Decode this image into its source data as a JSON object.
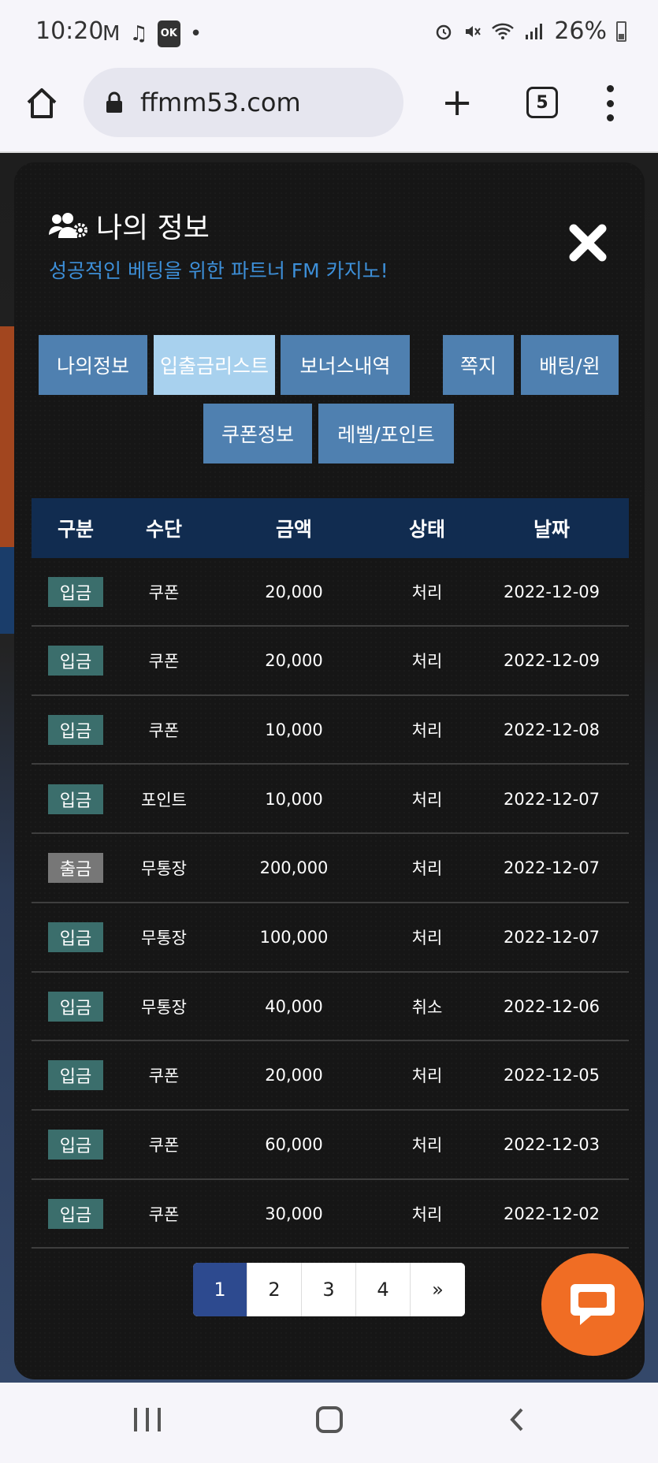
{
  "status_bar": {
    "time": "10:20",
    "left_icons": [
      "gmail-icon",
      "music-icon",
      "ok-icon",
      "dot-icon"
    ],
    "ok_label": "OK",
    "battery": "26%"
  },
  "browser": {
    "url": "ffmm53.com",
    "tab_count": "5"
  },
  "modal": {
    "title": "나의 정보",
    "subtitle": "성공적인 베팅을 위한 파트너 FM 카지노!",
    "tabs": [
      {
        "label": "나의정보",
        "active": false
      },
      {
        "label": "입출금리스트",
        "active": true
      },
      {
        "label": "보너스내역",
        "active": false
      },
      {
        "label": "쪽지",
        "active": false
      },
      {
        "label": "배팅/윈",
        "active": false
      },
      {
        "label": "쿠폰정보",
        "active": false
      },
      {
        "label": "레벨/포인트",
        "active": false
      }
    ]
  },
  "table": {
    "headers": [
      "구분",
      "수단",
      "금액",
      "상태",
      "날짜"
    ],
    "rows": [
      {
        "type": "입금",
        "method": "쿠폰",
        "amount": "20,000",
        "status": "처리",
        "date": "2022-12-09"
      },
      {
        "type": "입금",
        "method": "쿠폰",
        "amount": "20,000",
        "status": "처리",
        "date": "2022-12-09"
      },
      {
        "type": "입금",
        "method": "쿠폰",
        "amount": "10,000",
        "status": "처리",
        "date": "2022-12-08"
      },
      {
        "type": "입금",
        "method": "포인트",
        "amount": "10,000",
        "status": "처리",
        "date": "2022-12-07"
      },
      {
        "type": "출금",
        "method": "무통장",
        "amount": "200,000",
        "status": "처리",
        "date": "2022-12-07"
      },
      {
        "type": "입금",
        "method": "무통장",
        "amount": "100,000",
        "status": "처리",
        "date": "2022-12-07"
      },
      {
        "type": "입금",
        "method": "무통장",
        "amount": "40,000",
        "status": "취소",
        "date": "2022-12-06"
      },
      {
        "type": "입금",
        "method": "쿠폰",
        "amount": "20,000",
        "status": "처리",
        "date": "2022-12-05"
      },
      {
        "type": "입금",
        "method": "쿠폰",
        "amount": "60,000",
        "status": "처리",
        "date": "2022-12-03"
      },
      {
        "type": "입금",
        "method": "쿠폰",
        "amount": "30,000",
        "status": "처리",
        "date": "2022-12-02"
      }
    ]
  },
  "pagination": {
    "pages": [
      "1",
      "2",
      "3",
      "4",
      "»"
    ],
    "current": "1"
  },
  "colors": {
    "accent_blue": "#3d8fd8",
    "tab_bg": "#4f80b0",
    "tab_active_bg": "#a8d1ee",
    "deposit_badge": "#3b6e6c",
    "withdraw_badge": "#777777",
    "chat_button": "#f06d24",
    "header_bg": "#112c50"
  }
}
